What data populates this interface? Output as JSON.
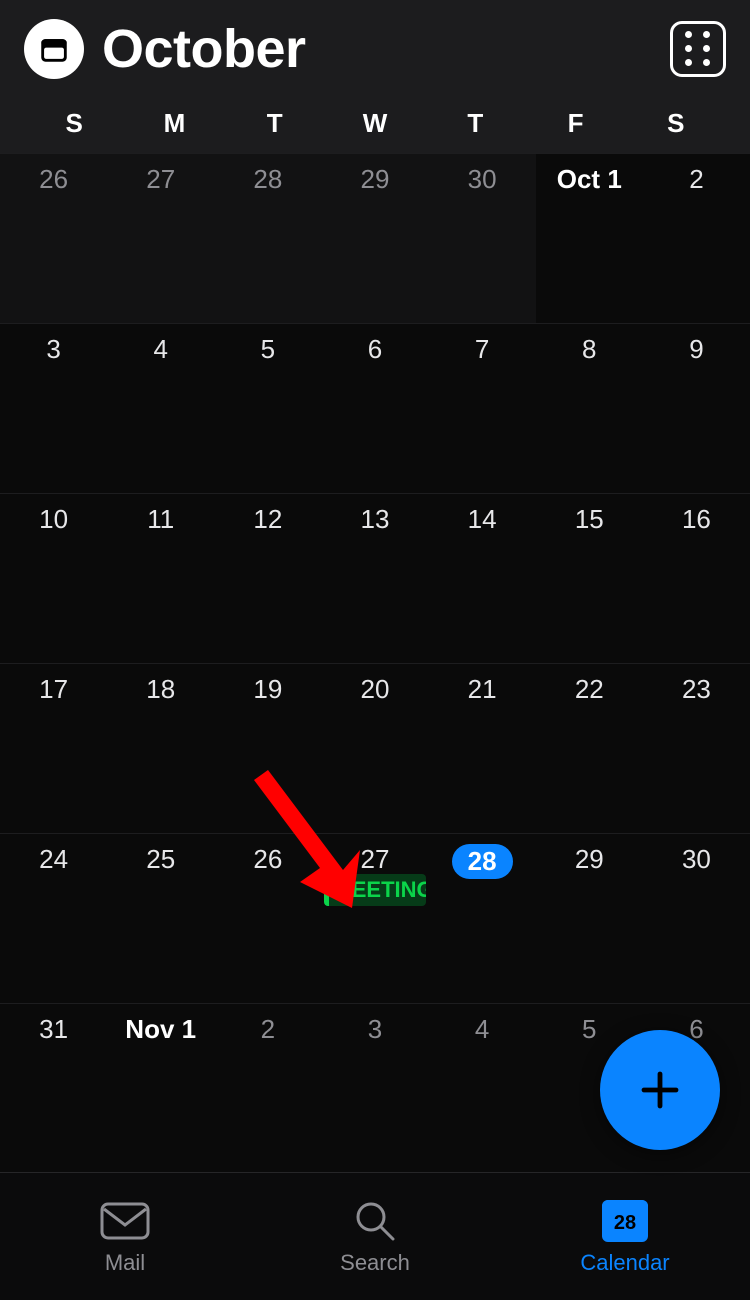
{
  "header": {
    "month_title": "October"
  },
  "weekdays": [
    "S",
    "M",
    "T",
    "W",
    "T",
    "F",
    "S"
  ],
  "weeks": [
    [
      {
        "label": "26",
        "dim": true
      },
      {
        "label": "27",
        "dim": true
      },
      {
        "label": "28",
        "dim": true
      },
      {
        "label": "29",
        "dim": true
      },
      {
        "label": "30",
        "dim": true
      },
      {
        "label": "Oct 1",
        "dim": false,
        "whitebold": true
      },
      {
        "label": "2",
        "dim": false
      }
    ],
    [
      {
        "label": "3"
      },
      {
        "label": "4"
      },
      {
        "label": "5"
      },
      {
        "label": "6"
      },
      {
        "label": "7"
      },
      {
        "label": "8"
      },
      {
        "label": "9"
      }
    ],
    [
      {
        "label": "10"
      },
      {
        "label": "11"
      },
      {
        "label": "12"
      },
      {
        "label": "13"
      },
      {
        "label": "14"
      },
      {
        "label": "15"
      },
      {
        "label": "16"
      }
    ],
    [
      {
        "label": "17"
      },
      {
        "label": "18"
      },
      {
        "label": "19"
      },
      {
        "label": "20"
      },
      {
        "label": "21"
      },
      {
        "label": "22"
      },
      {
        "label": "23"
      }
    ],
    [
      {
        "label": "24"
      },
      {
        "label": "25"
      },
      {
        "label": "26"
      },
      {
        "label": "27",
        "event": "MEETING"
      },
      {
        "label": "28",
        "today": true
      },
      {
        "label": "29"
      },
      {
        "label": "30"
      }
    ],
    [
      {
        "label": "31"
      },
      {
        "label": "Nov 1",
        "whitebold": true,
        "next": true
      },
      {
        "label": "2",
        "next": true
      },
      {
        "label": "3",
        "next": true
      },
      {
        "label": "4",
        "next": true
      },
      {
        "label": "5",
        "next": true
      },
      {
        "label": "6",
        "next": true
      }
    ]
  ],
  "event_label": "MEETING",
  "tabs": {
    "mail": "Mail",
    "search": "Search",
    "calendar": "Calendar",
    "calendar_day": "28"
  },
  "colors": {
    "accent": "#0a84ff",
    "event_green": "#0bd44a",
    "arrow_red": "#ff0000"
  }
}
